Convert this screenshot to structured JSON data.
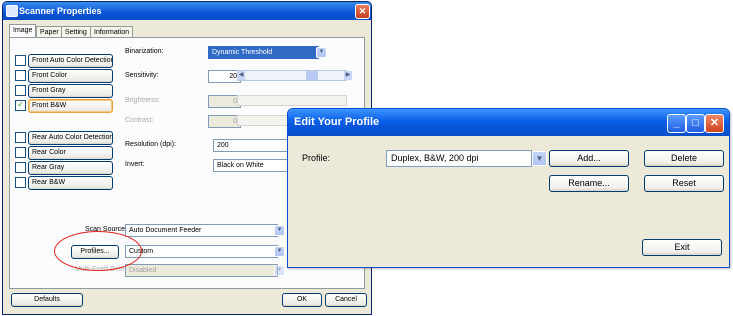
{
  "scanner_window": {
    "title": "Scanner Properties",
    "tabs": [
      "Image",
      "Paper",
      "Setting",
      "Information"
    ],
    "image_types": [
      {
        "label": "Front Auto Color Detection",
        "checked": false
      },
      {
        "label": "Front Color",
        "checked": false
      },
      {
        "label": "Front Gray",
        "checked": false
      },
      {
        "label": "Front B&W",
        "checked": true
      },
      {
        "label": "Rear Auto Color Detection",
        "checked": false
      },
      {
        "label": "Rear Color",
        "checked": false
      },
      {
        "label": "Rear Gray",
        "checked": false
      },
      {
        "label": "Rear B&W",
        "checked": false
      }
    ],
    "binarization_label": "Binarization:",
    "binarization_value": "Dynamic Threshold",
    "sensitivity_label": "Sensitivity:",
    "sensitivity_value": "20",
    "brightness_label": "Brightness:",
    "brightness_value": "0",
    "contrast_label": "Contrast:",
    "contrast_value": "0",
    "resolution_label": "Resolution (dpi):",
    "resolution_value": "200",
    "invert_label": "Invert:",
    "invert_value": "Black on White",
    "scan_source_label": "Scan Source:",
    "scan_source_value": "Auto Document Feeder",
    "profiles_button": "Profiles...",
    "profile_value": "Custom",
    "multifeed_label": "Multi-Feed Detection",
    "multifeed_value": "Disabled",
    "defaults_button": "Defaults",
    "ok_button": "OK",
    "cancel_button": "Cancel"
  },
  "profile_dialog": {
    "title": "Edit Your Profile",
    "profile_label": "Profile:",
    "profile_value": "Duplex, B&W, 200 dpi",
    "add_button": "Add...",
    "delete_button": "Delete",
    "rename_button": "Rename...",
    "reset_button": "Reset",
    "exit_button": "Exit"
  },
  "colors": {
    "xp_titlebar": "#0a5ee8",
    "dialog_face": "#ece9d8",
    "highlight": "#316ac5",
    "annotation": "#e0201a"
  }
}
